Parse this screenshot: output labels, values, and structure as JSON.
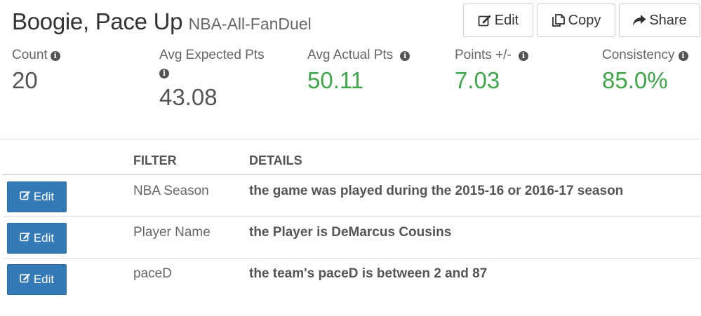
{
  "header": {
    "title": "Boogie, Pace Up",
    "subtitle": "NBA-All-FanDuel"
  },
  "actions": {
    "edit_label": "Edit",
    "copy_label": "Copy",
    "share_label": "Share"
  },
  "stats": [
    {
      "label": "Count",
      "value": "20",
      "color": "#555555"
    },
    {
      "label": "Avg Expected Pts",
      "value": "43.08",
      "color": "#555555"
    },
    {
      "label": "Avg Actual Pts",
      "value": "50.11",
      "color": "#3fa64a"
    },
    {
      "label": "Points +/-",
      "value": "7.03",
      "color": "#3fa64a"
    },
    {
      "label": "Consistency",
      "value": "85.0%",
      "color": "#3fa64a"
    }
  ],
  "table": {
    "columns": [
      "FILTER",
      "DETAILS"
    ],
    "edit_label": "Edit",
    "rows": [
      {
        "filter": "NBA Season",
        "details": "the game was played during the 2015-16 or 2016-17 season"
      },
      {
        "filter": "Player Name",
        "details": "the Player is DeMarcus Cousins"
      },
      {
        "filter": "paceD",
        "details": "the team's paceD is between 2 and 87"
      }
    ]
  },
  "icons": {
    "info": "info-circle-icon",
    "edit": "edit-icon",
    "copy": "copy-icon",
    "share": "share-icon"
  },
  "colors": {
    "positive": "#3fa64a",
    "primary_button": "#337ab7"
  }
}
